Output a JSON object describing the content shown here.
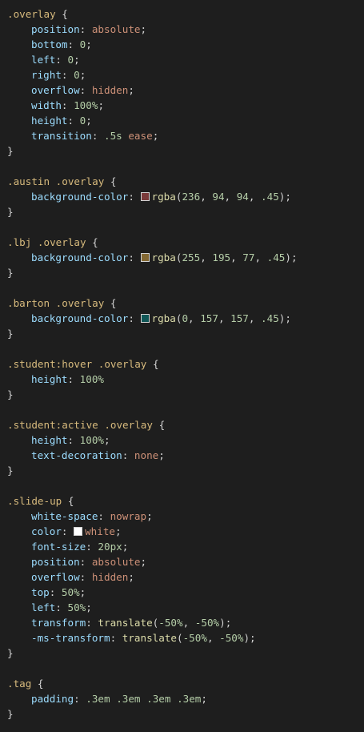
{
  "colors": {
    "background": "#1e1e1e",
    "selector": "#d7ba7d",
    "property": "#9cdcfe",
    "keyword": "#ce9178",
    "number": "#b5cea8",
    "function": "#dcdcaa",
    "text": "#d4d4d4"
  },
  "lines": [
    {
      "kind": "selector",
      "parts": [
        {
          "t": ".overlay",
          "c": "sel"
        },
        {
          "t": " {",
          "c": "punc"
        }
      ]
    },
    {
      "kind": "decl",
      "parts": [
        {
          "t": "position",
          "c": "prop"
        },
        {
          "t": ": ",
          "c": "punc"
        },
        {
          "t": "absolute",
          "c": "kw"
        },
        {
          "t": ";",
          "c": "punc"
        }
      ]
    },
    {
      "kind": "decl",
      "parts": [
        {
          "t": "bottom",
          "c": "prop"
        },
        {
          "t": ": ",
          "c": "punc"
        },
        {
          "t": "0",
          "c": "num"
        },
        {
          "t": ";",
          "c": "punc"
        }
      ]
    },
    {
      "kind": "decl",
      "parts": [
        {
          "t": "left",
          "c": "prop"
        },
        {
          "t": ": ",
          "c": "punc"
        },
        {
          "t": "0",
          "c": "num"
        },
        {
          "t": ";",
          "c": "punc"
        }
      ]
    },
    {
      "kind": "decl",
      "parts": [
        {
          "t": "right",
          "c": "prop"
        },
        {
          "t": ": ",
          "c": "punc"
        },
        {
          "t": "0",
          "c": "num"
        },
        {
          "t": ";",
          "c": "punc"
        }
      ]
    },
    {
      "kind": "decl",
      "parts": [
        {
          "t": "overflow",
          "c": "prop"
        },
        {
          "t": ": ",
          "c": "punc"
        },
        {
          "t": "hidden",
          "c": "kw"
        },
        {
          "t": ";",
          "c": "punc"
        }
      ]
    },
    {
      "kind": "decl",
      "parts": [
        {
          "t": "width",
          "c": "prop"
        },
        {
          "t": ": ",
          "c": "punc"
        },
        {
          "t": "100%",
          "c": "num"
        },
        {
          "t": ";",
          "c": "punc"
        }
      ]
    },
    {
      "kind": "decl",
      "parts": [
        {
          "t": "height",
          "c": "prop"
        },
        {
          "t": ": ",
          "c": "punc"
        },
        {
          "t": "0",
          "c": "num"
        },
        {
          "t": ";",
          "c": "punc"
        }
      ]
    },
    {
      "kind": "decl",
      "parts": [
        {
          "t": "transition",
          "c": "prop"
        },
        {
          "t": ": ",
          "c": "punc"
        },
        {
          "t": ".5s",
          "c": "num"
        },
        {
          "t": " ",
          "c": "punc"
        },
        {
          "t": "ease",
          "c": "kw"
        },
        {
          "t": ";",
          "c": "punc"
        }
      ]
    },
    {
      "kind": "close",
      "parts": [
        {
          "t": "}",
          "c": "punc"
        }
      ]
    },
    {
      "kind": "blank",
      "parts": []
    },
    {
      "kind": "selector",
      "parts": [
        {
          "t": ".austin .overlay",
          "c": "sel"
        },
        {
          "t": " {",
          "c": "punc"
        }
      ]
    },
    {
      "kind": "decl",
      "parts": [
        {
          "t": "background-color",
          "c": "prop"
        },
        {
          "t": ": ",
          "c": "punc"
        },
        {
          "swatch": "#ec5e5e",
          "alpha": "0.45"
        },
        {
          "t": "rgba",
          "c": "fn"
        },
        {
          "t": "(",
          "c": "punc"
        },
        {
          "t": "236",
          "c": "num"
        },
        {
          "t": ", ",
          "c": "punc"
        },
        {
          "t": "94",
          "c": "num"
        },
        {
          "t": ", ",
          "c": "punc"
        },
        {
          "t": "94",
          "c": "num"
        },
        {
          "t": ", ",
          "c": "punc"
        },
        {
          "t": ".45",
          "c": "num"
        },
        {
          "t": ");",
          "c": "punc"
        }
      ]
    },
    {
      "kind": "close",
      "parts": [
        {
          "t": "}",
          "c": "punc"
        }
      ]
    },
    {
      "kind": "blank",
      "parts": []
    },
    {
      "kind": "selector",
      "parts": [
        {
          "t": ".lbj .overlay",
          "c": "sel"
        },
        {
          "t": " {",
          "c": "punc"
        }
      ]
    },
    {
      "kind": "decl",
      "parts": [
        {
          "t": "background-color",
          "c": "prop"
        },
        {
          "t": ": ",
          "c": "punc"
        },
        {
          "swatch": "#ffc34d",
          "alpha": "0.45"
        },
        {
          "t": "rgba",
          "c": "fn"
        },
        {
          "t": "(",
          "c": "punc"
        },
        {
          "t": "255",
          "c": "num"
        },
        {
          "t": ", ",
          "c": "punc"
        },
        {
          "t": "195",
          "c": "num"
        },
        {
          "t": ", ",
          "c": "punc"
        },
        {
          "t": "77",
          "c": "num"
        },
        {
          "t": ", ",
          "c": "punc"
        },
        {
          "t": ".45",
          "c": "num"
        },
        {
          "t": ");",
          "c": "punc"
        }
      ]
    },
    {
      "kind": "close",
      "parts": [
        {
          "t": "}",
          "c": "punc"
        }
      ]
    },
    {
      "kind": "blank",
      "parts": []
    },
    {
      "kind": "selector",
      "parts": [
        {
          "t": ".barton .overlay",
          "c": "sel"
        },
        {
          "t": " {",
          "c": "punc"
        }
      ]
    },
    {
      "kind": "decl",
      "parts": [
        {
          "t": "background-color",
          "c": "prop"
        },
        {
          "t": ": ",
          "c": "punc"
        },
        {
          "swatch": "#009d9d",
          "alpha": "0.45"
        },
        {
          "t": "rgba",
          "c": "fn"
        },
        {
          "t": "(",
          "c": "punc"
        },
        {
          "t": "0",
          "c": "num"
        },
        {
          "t": ", ",
          "c": "punc"
        },
        {
          "t": "157",
          "c": "num"
        },
        {
          "t": ", ",
          "c": "punc"
        },
        {
          "t": "157",
          "c": "num"
        },
        {
          "t": ", ",
          "c": "punc"
        },
        {
          "t": ".45",
          "c": "num"
        },
        {
          "t": ");",
          "c": "punc"
        }
      ]
    },
    {
      "kind": "close",
      "parts": [
        {
          "t": "}",
          "c": "punc"
        }
      ]
    },
    {
      "kind": "blank",
      "parts": []
    },
    {
      "kind": "selector",
      "parts": [
        {
          "t": ".student:hover .overlay",
          "c": "sel"
        },
        {
          "t": " {",
          "c": "punc"
        }
      ]
    },
    {
      "kind": "decl",
      "parts": [
        {
          "t": "height",
          "c": "prop"
        },
        {
          "t": ": ",
          "c": "punc"
        },
        {
          "t": "100%",
          "c": "num"
        }
      ]
    },
    {
      "kind": "close",
      "parts": [
        {
          "t": "}",
          "c": "punc"
        }
      ]
    },
    {
      "kind": "blank",
      "parts": []
    },
    {
      "kind": "selector",
      "parts": [
        {
          "t": ".student:active .overlay",
          "c": "sel"
        },
        {
          "t": " {",
          "c": "punc"
        }
      ]
    },
    {
      "kind": "decl",
      "parts": [
        {
          "t": "height",
          "c": "prop"
        },
        {
          "t": ": ",
          "c": "punc"
        },
        {
          "t": "100%",
          "c": "num"
        },
        {
          "t": ";",
          "c": "punc"
        }
      ]
    },
    {
      "kind": "decl",
      "parts": [
        {
          "t": "text-decoration",
          "c": "prop"
        },
        {
          "t": ": ",
          "c": "punc"
        },
        {
          "t": "none",
          "c": "kw"
        },
        {
          "t": ";",
          "c": "punc"
        }
      ]
    },
    {
      "kind": "close",
      "parts": [
        {
          "t": "}",
          "c": "punc"
        }
      ]
    },
    {
      "kind": "blank",
      "parts": []
    },
    {
      "kind": "selector",
      "parts": [
        {
          "t": ".slide-up",
          "c": "sel"
        },
        {
          "t": " {",
          "c": "punc"
        }
      ]
    },
    {
      "kind": "decl",
      "parts": [
        {
          "t": "white-space",
          "c": "prop"
        },
        {
          "t": ": ",
          "c": "punc"
        },
        {
          "t": "nowrap",
          "c": "kw"
        },
        {
          "t": ";",
          "c": "punc"
        }
      ]
    },
    {
      "kind": "decl",
      "parts": [
        {
          "t": "color",
          "c": "prop"
        },
        {
          "t": ": ",
          "c": "punc"
        },
        {
          "swatch": "#ffffff",
          "alpha": "1"
        },
        {
          "t": "white",
          "c": "kw"
        },
        {
          "t": ";",
          "c": "punc"
        }
      ]
    },
    {
      "kind": "decl",
      "parts": [
        {
          "t": "font-size",
          "c": "prop"
        },
        {
          "t": ": ",
          "c": "punc"
        },
        {
          "t": "20px",
          "c": "num"
        },
        {
          "t": ";",
          "c": "punc"
        }
      ]
    },
    {
      "kind": "decl",
      "parts": [
        {
          "t": "position",
          "c": "prop"
        },
        {
          "t": ": ",
          "c": "punc"
        },
        {
          "t": "absolute",
          "c": "kw"
        },
        {
          "t": ";",
          "c": "punc"
        }
      ]
    },
    {
      "kind": "decl",
      "parts": [
        {
          "t": "overflow",
          "c": "prop"
        },
        {
          "t": ": ",
          "c": "punc"
        },
        {
          "t": "hidden",
          "c": "kw"
        },
        {
          "t": ";",
          "c": "punc"
        }
      ]
    },
    {
      "kind": "decl",
      "parts": [
        {
          "t": "top",
          "c": "prop"
        },
        {
          "t": ": ",
          "c": "punc"
        },
        {
          "t": "50%",
          "c": "num"
        },
        {
          "t": ";",
          "c": "punc"
        }
      ]
    },
    {
      "kind": "decl",
      "parts": [
        {
          "t": "left",
          "c": "prop"
        },
        {
          "t": ": ",
          "c": "punc"
        },
        {
          "t": "50%",
          "c": "num"
        },
        {
          "t": ";",
          "c": "punc"
        }
      ]
    },
    {
      "kind": "decl",
      "parts": [
        {
          "t": "transform",
          "c": "prop"
        },
        {
          "t": ": ",
          "c": "punc"
        },
        {
          "t": "translate",
          "c": "fn"
        },
        {
          "t": "(",
          "c": "punc"
        },
        {
          "t": "-50%",
          "c": "num"
        },
        {
          "t": ", ",
          "c": "punc"
        },
        {
          "t": "-50%",
          "c": "num"
        },
        {
          "t": ");",
          "c": "punc"
        }
      ]
    },
    {
      "kind": "decl",
      "parts": [
        {
          "t": "-ms-transform",
          "c": "prop"
        },
        {
          "t": ": ",
          "c": "punc"
        },
        {
          "t": "translate",
          "c": "fn"
        },
        {
          "t": "(",
          "c": "punc"
        },
        {
          "t": "-50%",
          "c": "num"
        },
        {
          "t": ", ",
          "c": "punc"
        },
        {
          "t": "-50%",
          "c": "num"
        },
        {
          "t": ");",
          "c": "punc"
        }
      ]
    },
    {
      "kind": "close",
      "parts": [
        {
          "t": "}",
          "c": "punc"
        }
      ]
    },
    {
      "kind": "blank",
      "parts": []
    },
    {
      "kind": "selector",
      "parts": [
        {
          "t": ".tag",
          "c": "sel"
        },
        {
          "t": " {",
          "c": "punc"
        }
      ]
    },
    {
      "kind": "decl",
      "parts": [
        {
          "t": "padding",
          "c": "prop"
        },
        {
          "t": ": ",
          "c": "punc"
        },
        {
          "t": ".3em",
          "c": "num"
        },
        {
          "t": " ",
          "c": "punc"
        },
        {
          "t": ".3em",
          "c": "num"
        },
        {
          "t": " ",
          "c": "punc"
        },
        {
          "t": ".3em",
          "c": "num"
        },
        {
          "t": " ",
          "c": "punc"
        },
        {
          "t": ".3em",
          "c": "num"
        },
        {
          "t": ";",
          "c": "punc"
        }
      ]
    },
    {
      "kind": "close",
      "parts": [
        {
          "t": "}",
          "c": "punc"
        }
      ]
    }
  ]
}
